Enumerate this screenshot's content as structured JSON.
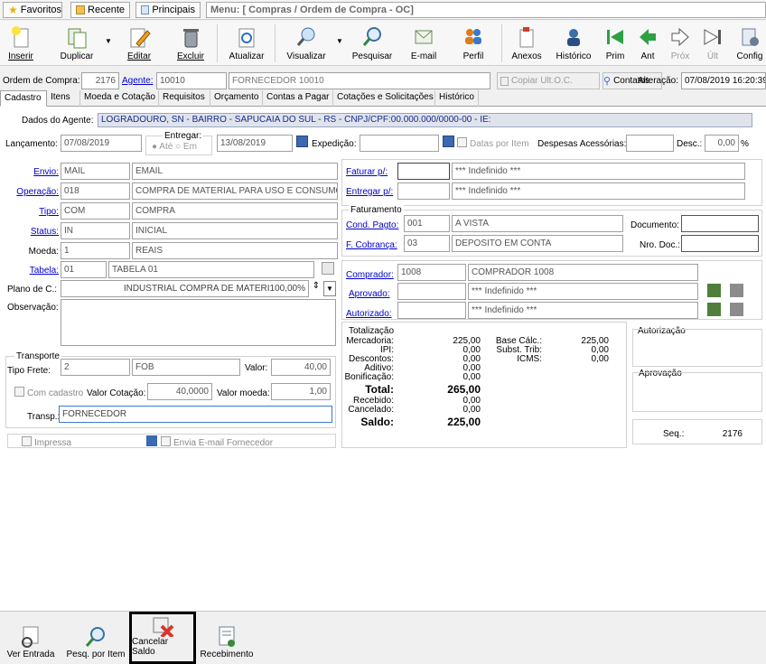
{
  "topbar": {
    "favoritos": "Favoritos",
    "recente": "Recente",
    "principais": "Principais",
    "menu_title": "Menu: [ Compras / Ordem de Compra - OC]"
  },
  "toolbar": {
    "inserir": "Inserir",
    "duplicar": "Duplicar",
    "editar": "Editar",
    "excluir": "Excluir",
    "atualizar": "Atualizar",
    "visualizar": "Visualizar",
    "pesquisar": "Pesquisar",
    "email": "E-mail",
    "perfil": "Perfil",
    "anexos": "Anexos",
    "historico": "Histórico",
    "prim": "Prim",
    "ant": "Ant",
    "prox": "Próx",
    "ult": "Últ",
    "config": "Config"
  },
  "header": {
    "ordem_label": "Ordem de Compra:",
    "ordem_value": "2176",
    "agente_label": "Agente:",
    "agente_code": "10010",
    "agente_name": "FORNECEDOR 10010",
    "copiar_label": "Copiar Ult.O.C.",
    "contatos_label": "Contatos",
    "alteracao_label": "Alteração:",
    "alteracao_value": "07/08/2019 16:20:39"
  },
  "tabs": [
    "Cadastro",
    "Itens",
    "Moeda e Cotação",
    "Requisitos",
    "Orçamento",
    "Contas a Pagar",
    "Cotações e Solicitações",
    "Histórico"
  ],
  "dados": {
    "label": "Dados do Agente:",
    "value": "LOGRADOURO, SN - BAIRRO - SAPUCAIA DO SUL - RS - CNPJ/CPF:00.000.000/0000-00 - IE:"
  },
  "lancamento": {
    "label": "Lançamento:",
    "value": "07/08/2019",
    "entregar_label": "Entregar:",
    "ate": "Até",
    "em": "Em",
    "entregar_date": "13/08/2019",
    "expedicao_label": "Expedição:",
    "expedicao_value": "",
    "datas_item": "Datas por Item",
    "despesas_label": "Despesas Acessórias:",
    "despesas_value": "",
    "desc_label": "Desc.:",
    "desc_value": "0,00",
    "pct": "%"
  },
  "left": {
    "envio": {
      "label": "Envio:",
      "code": "MAIL",
      "desc": "EMAIL"
    },
    "operacao": {
      "label": "Operação:",
      "code": "018",
      "desc": "COMPRA DE MATERIAL PARA USO E CONSUMO"
    },
    "tipo": {
      "label": "Tipo:",
      "code": "COM",
      "desc": "COMPRA"
    },
    "status": {
      "label": "Status:",
      "code": "IN",
      "desc": "INICIAL"
    },
    "moeda": {
      "label": "Moeda:",
      "code": "1",
      "desc": "REAIS"
    },
    "tabela": {
      "label": "Tabela:",
      "code": "01",
      "desc": "TABELA 01"
    },
    "plano": {
      "label": "Plano de C.:",
      "value": "INDUSTRIAL   COMPRA DE MATERI100,00%"
    },
    "observacao_label": "Observação:"
  },
  "transporte": {
    "title": "Transporte",
    "tipo_frete_label": "Tipo Frete:",
    "tipo_frete_code": "2",
    "tipo_frete_desc": "FOB",
    "valor_label": "Valor:",
    "valor_value": "40,00",
    "com_cadastro": "Com cadastro",
    "valor_cotacao_label": "Valor Cotação:",
    "valor_cotacao_value": "40,0000",
    "valor_moeda_label": "Valor moeda:",
    "valor_moeda_value": "1,00",
    "transp_label": "Transp.:",
    "transp_value": "FORNECEDOR"
  },
  "impressa": "Impressa",
  "envia_email": "Envia E-mail Fornecedor",
  "right": {
    "faturar": {
      "label": "Faturar p/:",
      "value": "*** Indefinido ***"
    },
    "entregar": {
      "label": "Entregar p/:",
      "value": "*** Indefinido ***"
    },
    "faturamento_title": "Faturamento",
    "cond_pagto": {
      "label": "Cond. Pagto:",
      "code": "001",
      "desc": "A VISTA"
    },
    "cobranca": {
      "label": "F. Cobrança:",
      "code": "03",
      "desc": "DEPOSITO EM CONTA"
    },
    "documento_label": "Documento:",
    "nro_doc_label": "Nro. Doc.:",
    "comprador": {
      "label": "Comprador:",
      "code": "1008",
      "desc": "COMPRADOR 1008"
    },
    "aprovado": {
      "label": "Aprovado:",
      "value": "*** Indefinido ***"
    },
    "autorizado": {
      "label": "Autorizado:",
      "value": "*** Indefinido ***"
    }
  },
  "totalizacao": {
    "title": "Totalização",
    "rows": [
      {
        "l": "Mercadoria:",
        "v": "225,00"
      },
      {
        "l": "IPI:",
        "v": "0,00"
      },
      {
        "l": "Descontos:",
        "v": "0,00"
      },
      {
        "l": "Aditivo:",
        "v": "0,00"
      },
      {
        "l": "Bonificação:",
        "v": "0,00"
      }
    ],
    "total_label": "Total:",
    "total_value": "265,00",
    "recebido_label": "Recebido:",
    "recebido_value": "0,00",
    "cancelado_label": "Cancelado:",
    "cancelado_value": "0,00",
    "saldo_label": "Saldo:",
    "saldo_value": "225,00",
    "base_calc_label": "Base Cálc.:",
    "base_calc_value": "225,00",
    "subst_label": "Subst. Trib:",
    "subst_value": "0,00",
    "icms_label": "ICMS:",
    "icms_value": "0,00"
  },
  "autorizacao_title": "Autorização",
  "aprovacao_title": "Aprovação",
  "seq_label": "Seq.:",
  "seq_value": "2176",
  "bottom": {
    "ver_entrada": "Ver Entrada",
    "pesq_item": "Pesq. por Item",
    "cancelar_saldo": "Cancelar Saldo",
    "recebimento": "Recebimento"
  }
}
